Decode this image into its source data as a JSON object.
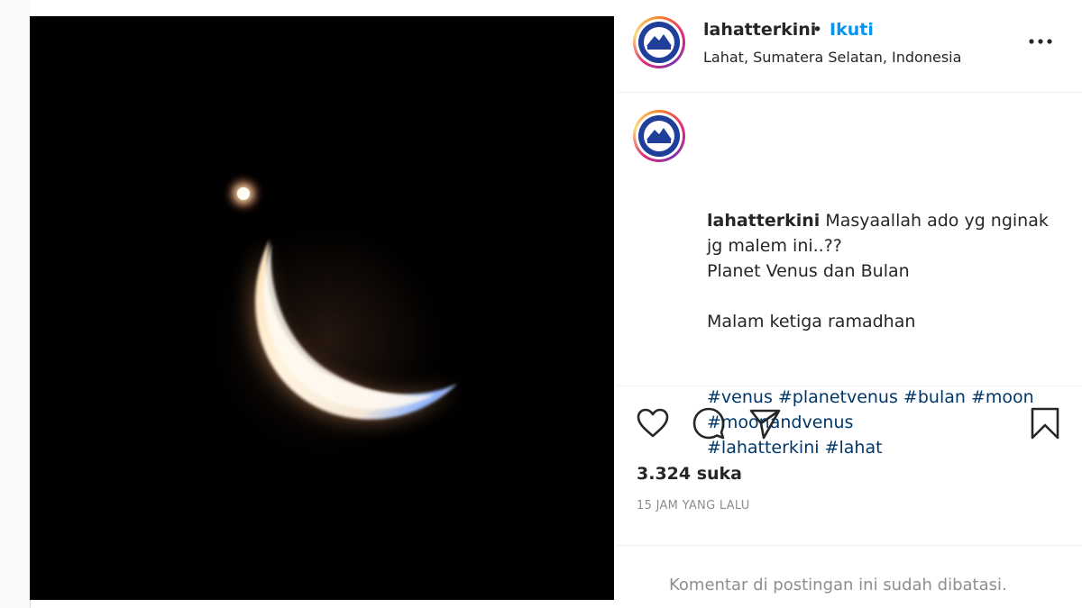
{
  "post": {
    "image_alt": "Crescent moon and Venus in the night sky"
  },
  "header": {
    "username": "lahatterkini",
    "separator": "•",
    "follow_label": "Ikuti",
    "location": "Lahat, Sumatera Selatan, Indonesia",
    "more_icon": "more-horizontal-icon"
  },
  "caption": {
    "username": "lahatterkini",
    "line1": "Masyaallah ado yg nginak",
    "line2": "jg malem ini..??",
    "line3": "Planet Venus dan Bulan",
    "line4": "Malam ketiga ramadhan",
    "tags_line1": "#venus #planetvenus #bulan #moon",
    "tags_line2": "#moonandvenus",
    "tags_line3": "#lahatterkini #lahat"
  },
  "actions": {
    "like_icon": "heart-icon",
    "comment_icon": "comment-icon",
    "share_icon": "paper-plane-icon",
    "save_icon": "bookmark-icon"
  },
  "likes": "3.324 suka",
  "timestamp": "15 JAM YANG LALU",
  "comments_note": "Komentar di postingan ini sudah dibatasi.",
  "colors": {
    "follow": "#0095f6",
    "hashtag": "#00376b",
    "muted": "#8e8e8e"
  }
}
